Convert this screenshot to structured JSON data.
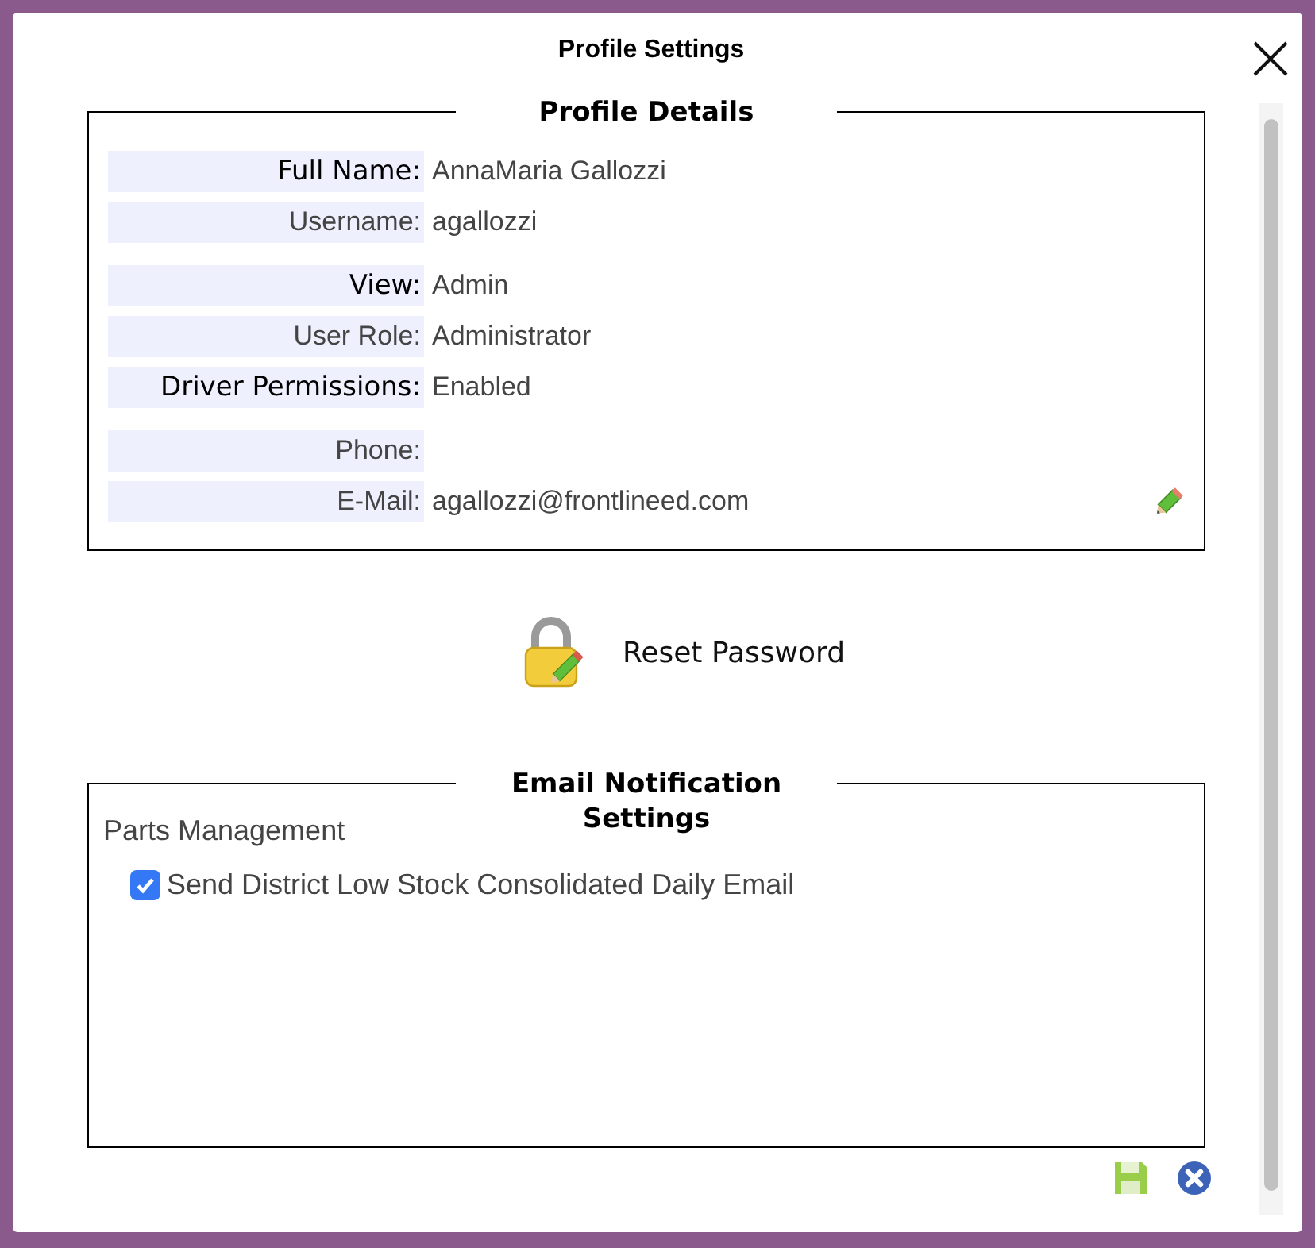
{
  "dialog": {
    "title": "Profile Settings"
  },
  "profile_details": {
    "legend": "Profile Details",
    "groups": [
      {
        "fields": [
          {
            "label": "Full Name:",
            "value": "AnnaMaria Gallozzi",
            "kind": "major"
          },
          {
            "label": "Username:",
            "value": "agallozzi",
            "kind": "minor"
          }
        ]
      },
      {
        "fields": [
          {
            "label": "View:",
            "value": "Admin",
            "kind": "major"
          },
          {
            "label": "User Role:",
            "value": "Administrator",
            "kind": "minor"
          },
          {
            "label": "Driver Permissions:",
            "value": "Enabled",
            "kind": "major"
          }
        ]
      },
      {
        "fields": [
          {
            "label": "Phone:",
            "kind": "minor"
          },
          {
            "label": "E-Mail:",
            "value": "agallozzi@frontlineed.com",
            "kind": "minor",
            "editable": true
          }
        ]
      }
    ]
  },
  "reset_password": {
    "label": "Reset Password"
  },
  "email_notifications": {
    "legend": "Email Notification Settings",
    "sections": [
      {
        "heading": "Parts Management",
        "options": [
          {
            "label": "Send District Low Stock Consolidated Daily Email",
            "checked": true
          }
        ]
      }
    ]
  }
}
